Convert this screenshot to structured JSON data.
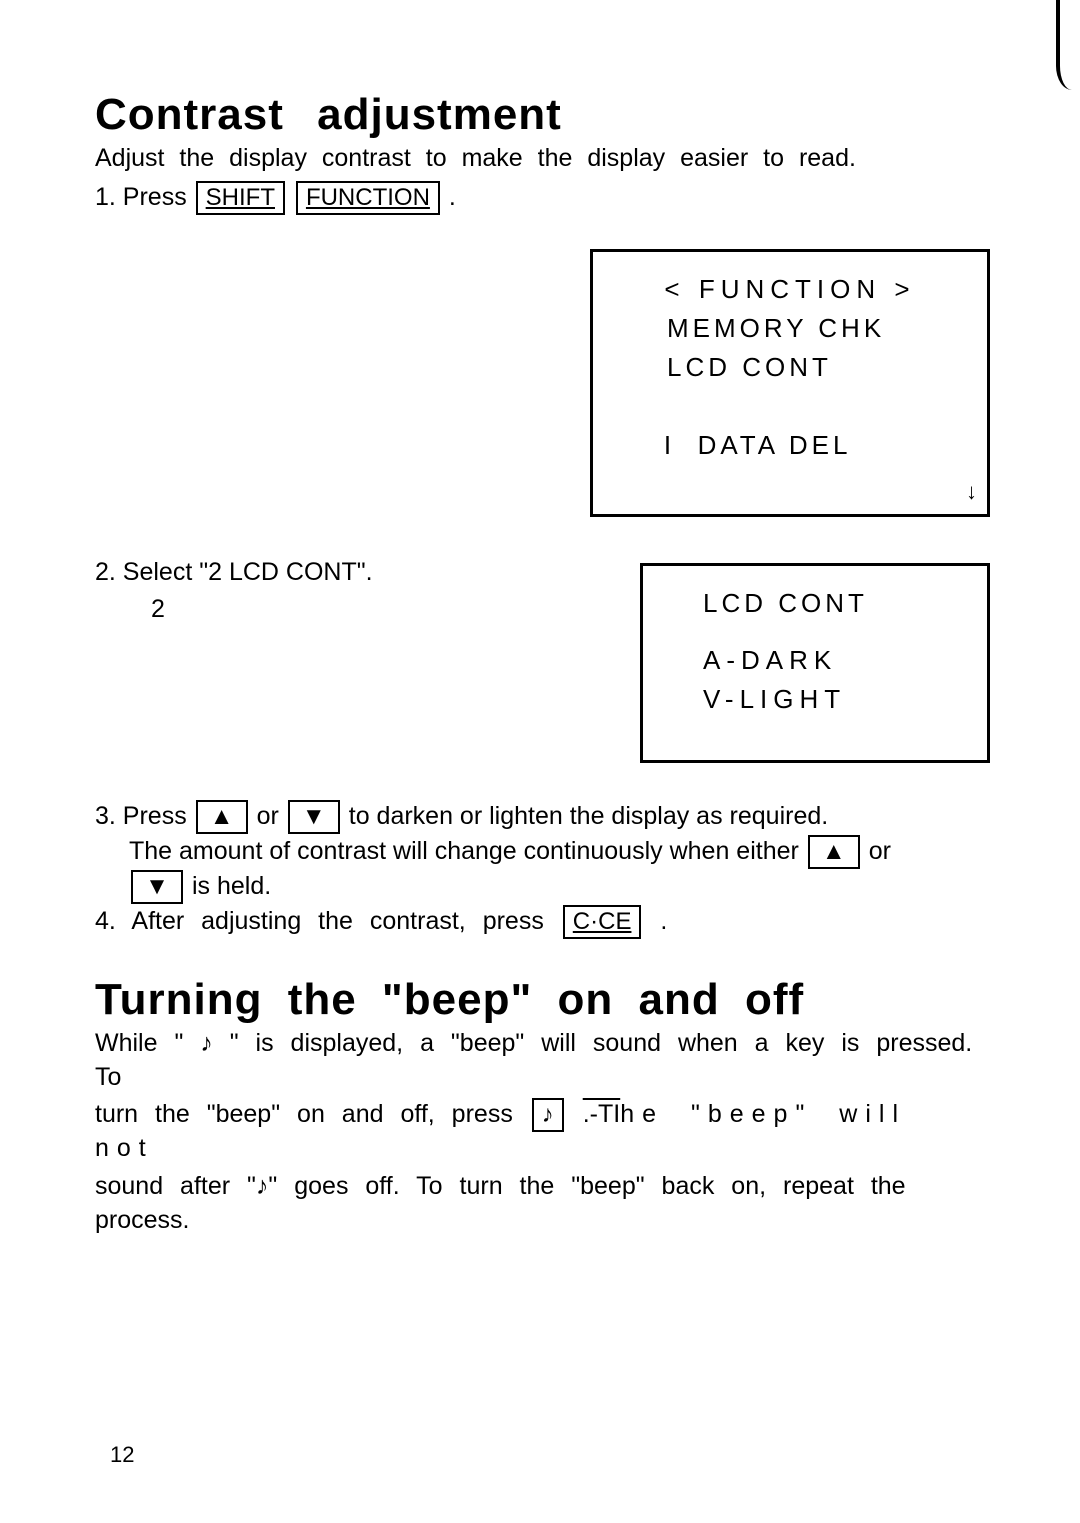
{
  "section1": {
    "heading": "Contrast adjustment",
    "intro": "Adjust the display contrast to make the display easier to read.",
    "step1_pre": "1. Press ",
    "key_shift": "SHIFT",
    "key_function": "FUNCTION",
    "screen1": {
      "heading": "< FUNCTION >",
      "l1": "MEMORY CHK",
      "l2": "LCD CONT",
      "l3_prefix": "I  ",
      "l3": "DATA DEL",
      "arrow": "↓"
    },
    "step2": "2. Select \"2 LCD CONT\".",
    "step2_num": "2",
    "screen2": {
      "l1": "LCD CONT",
      "l2": "A-DARK",
      "l3": "V-LIGHT"
    },
    "step3_pre": "3. Press ",
    "step3_mid1": " or ",
    "step3_mid2": " to darken or lighten the display as required.",
    "step3_line2a": "The amount of contrast will change continuously when either ",
    "step3_line2b": " or",
    "step3_line3": " is held.",
    "step4_pre": "4. After adjusting the contrast, press ",
    "key_cce": "C·CE",
    "arrow_up": "▲",
    "arrow_down": "▼"
  },
  "section2": {
    "heading": "Turning the \"beep\" on and off",
    "p1a": "While \" ",
    "note": "♪",
    "p1b": " \" is displayed, a \"beep\" will sound when a key is pressed. To",
    "p2a": "turn the \"beep\" on and off, press ",
    "key_note": "♪",
    "p2b_ocr": ".-TI",
    "p2c": "he \"beep\" will not",
    "p3a": "sound after \"",
    "p3b": "\" goes off. To turn the \"beep\" back on, repeat the process."
  },
  "page_number": "12"
}
